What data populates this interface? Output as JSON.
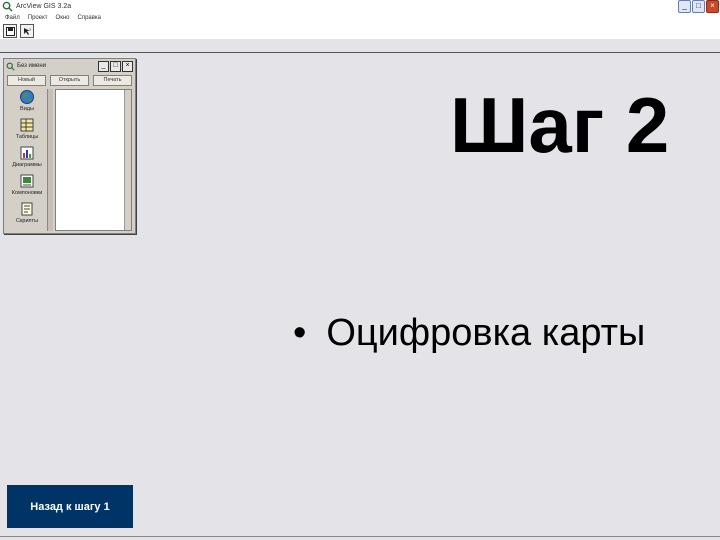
{
  "window": {
    "title": "ArcView GIS 3.2a",
    "min_label": "_",
    "max_label": "□",
    "close_label": "×"
  },
  "menubar": {
    "items": [
      "Файл",
      "Проект",
      "Окно",
      "Справка"
    ]
  },
  "toolbar": {
    "buttons": [
      {
        "icon": "save-icon"
      },
      {
        "icon": "help-pointer-icon"
      }
    ]
  },
  "project_window": {
    "title": "Без имени",
    "min_label": "_",
    "max_label": "□",
    "close_label": "×",
    "tabs": [
      "Новый",
      "Открыть",
      "Печать"
    ],
    "items": [
      {
        "label": "Виды",
        "icon": "globe-icon"
      },
      {
        "label": "Таблицы",
        "icon": "table-icon"
      },
      {
        "label": "Диаграммы",
        "icon": "chart-icon"
      },
      {
        "label": "Компоновки",
        "icon": "layout-icon"
      },
      {
        "label": "Скрипты",
        "icon": "script-icon"
      }
    ]
  },
  "slide": {
    "title": "Шаг 2",
    "bullet_symbol": "•",
    "bullet": "Оцифровка карты",
    "back_button": "Назад к шагу 1"
  },
  "colors": {
    "background": "#e4e4e8",
    "button_bg": "#003366",
    "close_button": "#c84a2c"
  }
}
